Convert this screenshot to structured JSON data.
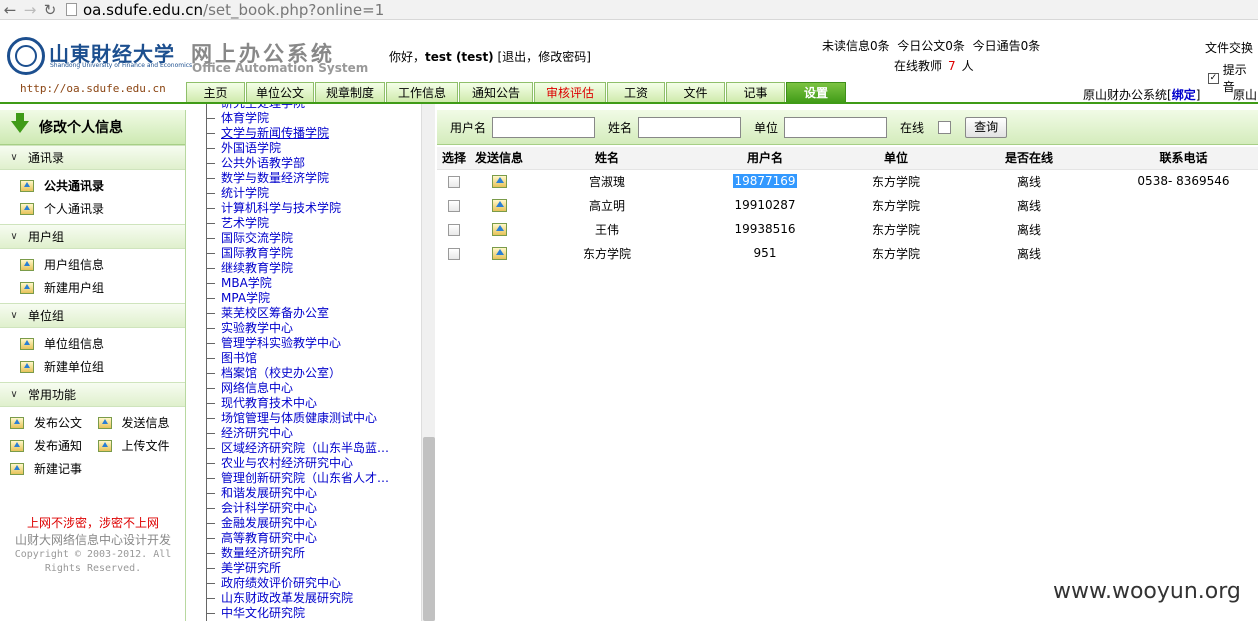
{
  "browser": {
    "url_host": "oa.sdufe.edu.cn",
    "url_path": "/set_book.php?online=1",
    "back_icon": "arrow-left-icon",
    "forward_icon": "arrow-right-icon",
    "reload_icon": "reload-icon"
  },
  "header": {
    "logo_cn": "山東財经大学",
    "logo_en": "Shandong University of Finance and Economics",
    "system_cn": "网上办公系统",
    "system_en": "Office Automation System",
    "site_url": "http://oa.sdufe.edu.cn",
    "greeting_prefix": "你好，",
    "user": "test (test)",
    "logout": "[退出，",
    "change_pw": "修改密码]",
    "unread": "未读信息0条",
    "today_doc": "今日公文0条",
    "today_notice": "今日通告0条",
    "online_label": "在线教师",
    "online_count": "7",
    "online_unit": "人",
    "file_exchange": "文件交换",
    "tip_label": "提示音",
    "old_system": "原山财办公系统[",
    "bind": "绑定",
    "old_system_end": "]",
    "old_right": "原山"
  },
  "tabs": [
    {
      "label": "主页"
    },
    {
      "label": "单位公文"
    },
    {
      "label": "规章制度"
    },
    {
      "label": "工作信息"
    },
    {
      "label": "通知公告"
    },
    {
      "label": "审核评估"
    },
    {
      "label": "工资"
    },
    {
      "label": "文件"
    },
    {
      "label": "记事"
    },
    {
      "label": "设置"
    }
  ],
  "sidebar": {
    "title": "修改个人信息",
    "groups": [
      {
        "label": "通讯录",
        "items": [
          "公共通讯录",
          "个人通讯录"
        ]
      },
      {
        "label": "用户组",
        "items": [
          "用户组信息",
          "新建用户组"
        ]
      },
      {
        "label": "单位组",
        "items": [
          "单位组信息",
          "新建单位组"
        ]
      },
      {
        "label": "常用功能",
        "items": []
      }
    ],
    "quick": [
      "发布公文",
      "发送信息",
      "发布通知",
      "上传文件",
      "新建记事"
    ],
    "footer_warn": "上网不涉密，涉密不上网",
    "footer_dev": "山财大网络信息中心设计开发",
    "footer_copy": "Copyright © 2003-2012. All Rights Reserved."
  },
  "tree": {
    "items": [
      "研究生处理学院",
      "体育学院",
      "文学与新闻传播学院",
      "外国语学院",
      "公共外语教学部",
      "数学与数量经济学院",
      "统计学院",
      "计算机科学与技术学院",
      "艺术学院",
      "国际交流学院",
      "国际教育学院",
      "继续教育学院",
      "MBA学院",
      "MPA学院",
      "莱芜校区筹备办公室",
      "实验教学中心",
      "管理学科实验教学中心",
      "图书馆",
      "档案馆（校史办公室）",
      "网络信息中心",
      "现代教育技术中心",
      "场馆管理与体质健康测试中心",
      "经济研究中心",
      "区域经济研究院（山东半岛蓝…",
      "农业与农村经济研究中心",
      "管理创新研究院（山东省人才…",
      "和谐发展研究中心",
      "会计科学研究中心",
      "金融发展研究中心",
      "高等教育研究中心",
      "数量经济研究所",
      "美学研究所",
      "政府绩效评价研究中心",
      "山东财政改革发展研究院",
      "中华文化研究院"
    ]
  },
  "search": {
    "username_label": "用户名",
    "name_label": "姓名",
    "unit_label": "单位",
    "online_label": "在线",
    "query_button": "查询"
  },
  "table": {
    "headers": [
      "选择",
      "发送信息",
      "姓名",
      "用户名",
      "单位",
      "是否在线",
      "联系电话"
    ],
    "rows": [
      {
        "name": "宫淑瑰",
        "username": "19877169",
        "unit": "东方学院",
        "online": "离线",
        "phone": "0538- 8369546"
      },
      {
        "name": "高立明",
        "username": "19910287",
        "unit": "东方学院",
        "online": "离线",
        "phone": ""
      },
      {
        "name": "王伟",
        "username": "19938516",
        "unit": "东方学院",
        "online": "离线",
        "phone": ""
      },
      {
        "name": "东方学院",
        "username": "951",
        "unit": "东方学院",
        "online": "离线",
        "phone": ""
      }
    ]
  },
  "watermark": "www.wooyun.org"
}
